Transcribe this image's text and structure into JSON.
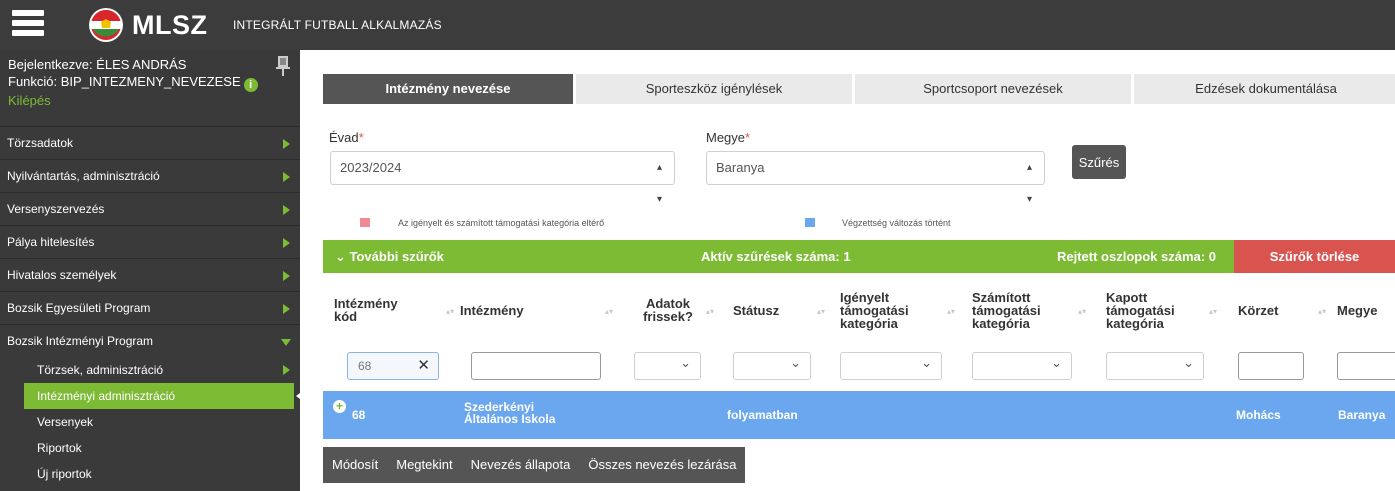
{
  "header": {
    "logo_text": "MLSZ",
    "app_title": "INTEGRÁLT FUTBALL ALKALMAZÁS"
  },
  "user": {
    "logged_in_as": "Bejelentkezve: ÉLES ANDRÁS",
    "function": "Funkció: BIP_INTEZMENY_NEVEZESE",
    "logout": "Kilépés"
  },
  "sidebar": {
    "items": [
      {
        "label": "Törzsadatok"
      },
      {
        "label": "Nyilvántartás, adminisztráció"
      },
      {
        "label": "Versenyszervezés"
      },
      {
        "label": "Pálya hitelesítés"
      },
      {
        "label": "Hivatalos személyek"
      },
      {
        "label": "Bozsik Egyesületi Program"
      },
      {
        "label": "Bozsik Intézményi Program"
      }
    ],
    "subitems": [
      {
        "label": "Törzsek, adminisztráció"
      },
      {
        "label": "Intézményi adminisztráció"
      },
      {
        "label": "Versenyek"
      },
      {
        "label": "Riportok"
      },
      {
        "label": "Új riportok"
      }
    ]
  },
  "tabs": [
    {
      "label": "Intézmény nevezése",
      "active": true
    },
    {
      "label": "Sporteszköz igénylések"
    },
    {
      "label": "Sportcsoport nevezések"
    },
    {
      "label": "Edzések dokumentálása"
    }
  ],
  "filters": {
    "season_label": "Évad",
    "season_value": "2023/2024",
    "county_label": "Megye",
    "county_value": "Baranya",
    "required_mark": "*",
    "filter_button": "Szűrés"
  },
  "legend": {
    "item1": "Az igényelt és számított támogatási kategória eltérő",
    "item1_color": "#f08a95",
    "item2": "Végzettség változás történt",
    "item2_color": "#6aa7ee"
  },
  "filterbar": {
    "more_filters": "További szűrők",
    "active_filters": "Aktív szűrések száma: 1",
    "hidden_columns": "Rejtett oszlopok száma: 0",
    "clear_filters": "Szűrők törlése"
  },
  "table": {
    "columns": [
      "Intézmény kód",
      "Intézmény",
      "Adatok frissek?",
      "Státusz",
      "Igényelt támogatási kategória",
      "Számított támogatási kategória",
      "Kapott támogatási kategória",
      "Körzet",
      "Megye"
    ],
    "filter_value_code": "68",
    "rows": [
      {
        "code": "68",
        "name": "Szederkényi Általános Iskola",
        "fresh": "",
        "status": "folyamatban",
        "requested": "",
        "calculated": "",
        "received": "",
        "district": "Mohács",
        "county": "Baranya"
      }
    ]
  },
  "actions": [
    {
      "label": "Módosít"
    },
    {
      "label": "Megtekint"
    },
    {
      "label": "Nevezés állapota"
    },
    {
      "label": "Összes nevezés lezárása"
    }
  ]
}
